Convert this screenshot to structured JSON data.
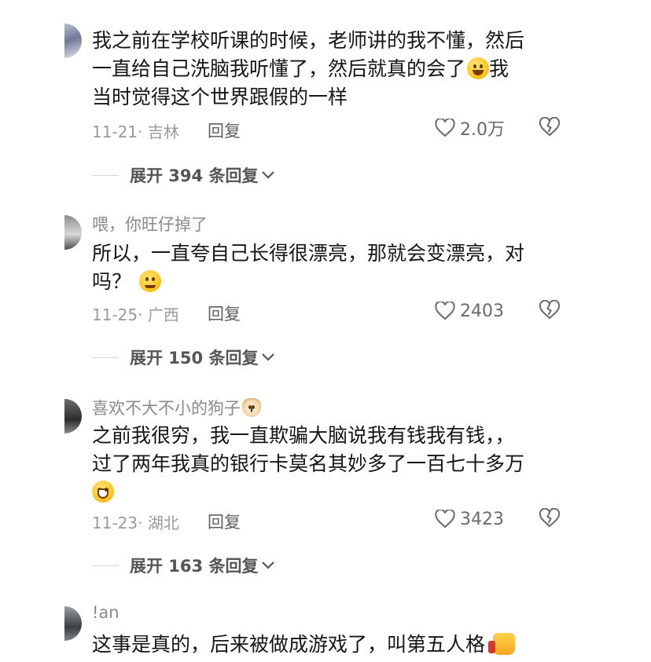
{
  "comments": [
    {
      "username": "",
      "lines": [
        "我之前在学校听课的时候，老师讲的我不懂，然后",
        "一直给自己洗脑我听懂了，然后就真的会了",
        "当时觉得这个世界跟假的一样"
      ],
      "line2_tail": "我",
      "date": "11-21· 吉林",
      "reply_label": "回复",
      "likes": "2.0万",
      "expand_label": "展开 394 条回复"
    },
    {
      "username": "喂，你旺仔掉了",
      "lines": [
        "所以，一直夸自己长得很漂亮，那就会变漂亮，对",
        "吗？"
      ],
      "date": "11-25· 广西",
      "reply_label": "回复",
      "likes": "2403",
      "expand_label": "展开 150 条回复"
    },
    {
      "username": "喜欢不大不小的狗子",
      "lines": [
        "之前我很穷，我一直欺骗大脑说我有钱我有钱，，",
        "过了两年我真的银行卡莫名其妙多了一百七十多万"
      ],
      "date": "11-23· 湖北",
      "reply_label": "回复",
      "likes": "3423",
      "expand_label": "展开 163 条回复"
    },
    {
      "username": "!an",
      "lines": [
        "这事是真的，后来被做成游戏了，叫第五人格"
      ]
    }
  ],
  "icons": {
    "like": "heart-outline-icon",
    "dislike": "broken-heart-icon",
    "expand": "chevron-down-icon",
    "emoji_laugh": "rolling-laughing-emoji",
    "emoji_smile": "smiling-emoji",
    "emoji_grin": "grinning-sweat-emoji",
    "emoji_dog": "dog-face-emoji",
    "emoji_thumb": "thumbs-up-emoji"
  }
}
